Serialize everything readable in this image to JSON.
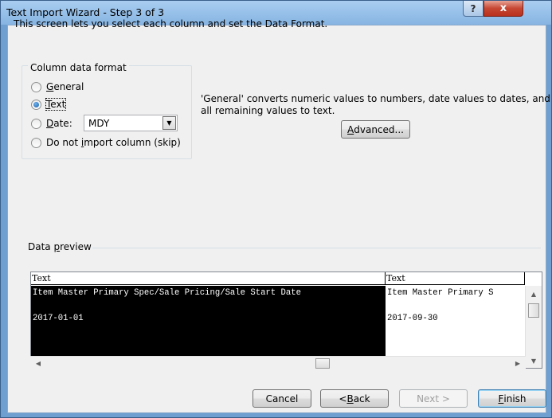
{
  "window": {
    "title": "Text Import Wizard - Step 3 of 3",
    "help_label": "?",
    "close_label": "x"
  },
  "intro": "This screen lets you select each column and set the Data Format.",
  "column_format": {
    "legend": "Column data format",
    "options": [
      {
        "label": "General",
        "access_key": "G",
        "rest": "eneral",
        "selected": false
      },
      {
        "label": "Text",
        "access_key": "T",
        "rest": "ext",
        "selected": true
      },
      {
        "label": "Date:",
        "access_key": "D",
        "rest": "ate:",
        "selected": false
      },
      {
        "label": "Do not import column (skip)",
        "pre": "Do not ",
        "access_key": "i",
        "rest": "mport column (skip)",
        "selected": false
      }
    ],
    "date_format_value": "MDY"
  },
  "description": "'General' converts numeric values to numbers, date values to dates, and all remaining values to text.",
  "advanced": {
    "label": "Advanced...",
    "access_key": "A",
    "rest": "dvanced..."
  },
  "preview": {
    "label_pre": "Data ",
    "label_key": "p",
    "label_rest": "review",
    "headers": [
      "Text",
      "Text"
    ],
    "rows": [
      [
        "Item Master Primary Spec/Sale Pricing/Sale Start Date",
        "Item Master Primary S"
      ],
      [
        "",
        ""
      ],
      [
        "2017-01-01",
        "2017-09-30"
      ]
    ]
  },
  "buttons": {
    "cancel": "Cancel",
    "back_pre": "< ",
    "back_key": "B",
    "back_rest": "ack",
    "next": "Next >",
    "finish_key": "F",
    "finish_rest": "inish"
  },
  "colors": {
    "titlebar": "#a9cdf0",
    "close": "#c64733",
    "dialog_bg": "#f0f0f0",
    "selected_column": "#000000"
  }
}
